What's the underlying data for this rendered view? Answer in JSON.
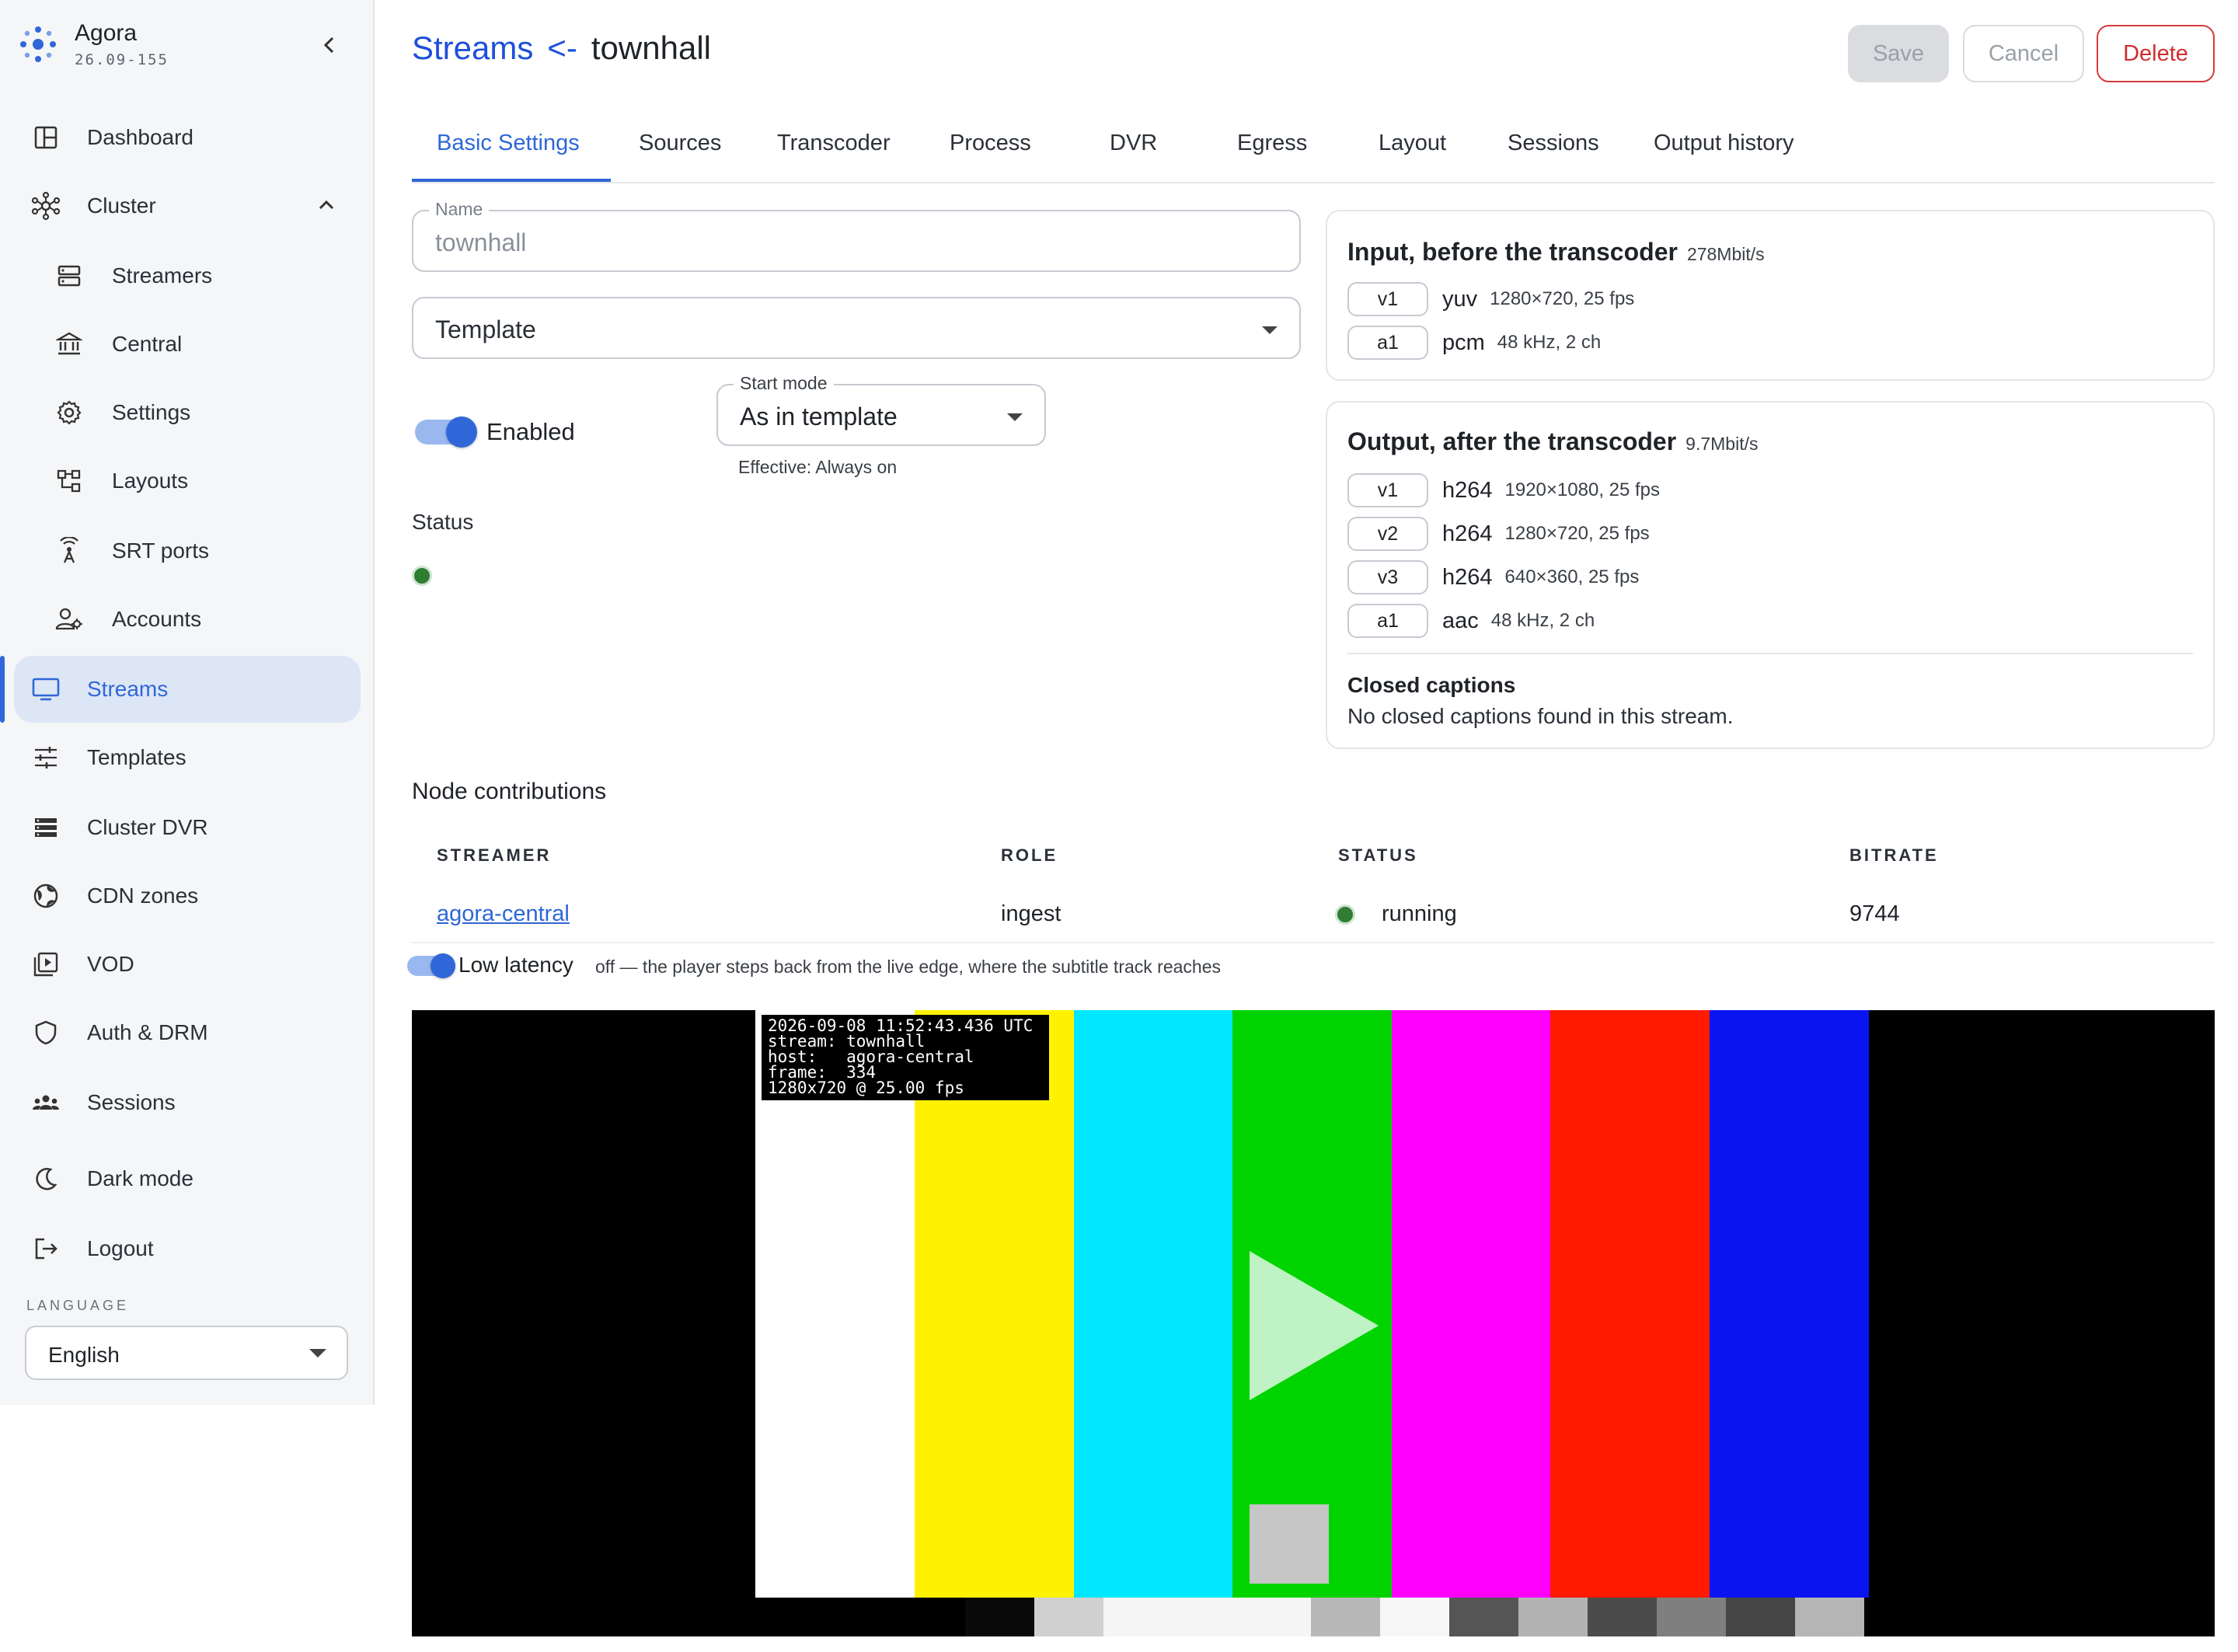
{
  "app": {
    "name": "Agora",
    "version": "26.09-155"
  },
  "sidebar": {
    "items": [
      {
        "label": "Dashboard",
        "icon": "dashboard-icon"
      },
      {
        "label": "Cluster",
        "icon": "cluster-icon",
        "expanded": true
      },
      {
        "label": "Streamers",
        "icon": "server-icon"
      },
      {
        "label": "Central",
        "icon": "bank-icon"
      },
      {
        "label": "Settings",
        "icon": "gear-icon"
      },
      {
        "label": "Layouts",
        "icon": "layouts-icon"
      },
      {
        "label": "SRT ports",
        "icon": "antenna-icon"
      },
      {
        "label": "Accounts",
        "icon": "accounts-icon"
      },
      {
        "label": "Streams",
        "icon": "monitor-icon",
        "active": true
      },
      {
        "label": "Templates",
        "icon": "sliders-icon"
      },
      {
        "label": "Cluster DVR",
        "icon": "storage-icon"
      },
      {
        "label": "CDN zones",
        "icon": "globe-icon"
      },
      {
        "label": "VOD",
        "icon": "video-library-icon"
      },
      {
        "label": "Auth & DRM",
        "icon": "shield-icon"
      },
      {
        "label": "Sessions",
        "icon": "group-icon"
      },
      {
        "label": "Dark mode",
        "icon": "moon-icon"
      },
      {
        "label": "Logout",
        "icon": "logout-icon"
      }
    ],
    "language_label": "LANGUAGE",
    "language_value": "English"
  },
  "header": {
    "crumb_parent": "Streams",
    "crumb_sep": "<-",
    "crumb_current": "townhall",
    "save_label": "Save",
    "cancel_label": "Cancel",
    "delete_label": "Delete"
  },
  "tabs": [
    "Basic Settings",
    "Sources",
    "Transcoder",
    "Process",
    "DVR",
    "Egress",
    "Layout",
    "Sessions",
    "Output history"
  ],
  "form": {
    "name_label": "Name",
    "name_value": "townhall",
    "template_value": "Template",
    "enabled_label": "Enabled",
    "start_mode_label": "Start mode",
    "start_mode_value": "As in template",
    "effective_text": "Effective: Always on",
    "status_label": "Status"
  },
  "input_card": {
    "title": "Input, before the transcoder",
    "rate": "278Mbit/s",
    "tracks": [
      {
        "id": "v1",
        "codec": "yuv",
        "detail": "1280×720, 25 fps"
      },
      {
        "id": "a1",
        "codec": "pcm",
        "detail": "48 kHz, 2 ch"
      }
    ]
  },
  "output_card": {
    "title": "Output, after the transcoder",
    "rate": "9.7Mbit/s",
    "tracks": [
      {
        "id": "v1",
        "codec": "h264",
        "detail": "1920×1080, 25 fps"
      },
      {
        "id": "v2",
        "codec": "h264",
        "detail": "1280×720, 25 fps"
      },
      {
        "id": "v3",
        "codec": "h264",
        "detail": "640×360, 25 fps"
      },
      {
        "id": "a1",
        "codec": "aac",
        "detail": "48 kHz, 2 ch"
      }
    ],
    "cc_title": "Closed captions",
    "cc_text": "No closed captions found in this stream."
  },
  "node_contributions": {
    "title": "Node contributions",
    "columns": [
      "STREAMER",
      "ROLE",
      "STATUS",
      "BITRATE"
    ],
    "rows": [
      {
        "streamer": "agora-central",
        "role": "ingest",
        "status": "running",
        "bitrate": "9744"
      }
    ]
  },
  "low_latency": {
    "label": "Low latency",
    "note": "off — the player steps back from the live edge, where the subtitle track reaches"
  },
  "video": {
    "overlay_lines": [
      "2026-09-08 11:52:43.436 UTC",
      "stream: townhall",
      "host:   agora-central",
      "frame:  334",
      "1280x720 @ 25.00 fps"
    ],
    "bar_colors": [
      "#ffffff",
      "#fff200",
      "#00e7ff",
      "#00d400",
      "#ff00ff",
      "#ff1a00",
      "#0a14f0"
    ],
    "gray_colors": [
      "#0a0a0a",
      "#d0d0d0",
      "#f5f5f5",
      "#f5f5f5",
      "#f5f5f5",
      "#b8b8b8",
      "#f7f7f7",
      "#555555",
      "#b3b3b3",
      "#4b4b4b",
      "#7f7f7f",
      "#454545",
      "#b5b5b5"
    ],
    "play_icon": "play-icon"
  },
  "colors": {
    "accent": "#2f67d8",
    "link": "#1d4fd8",
    "danger": "#d12c2c",
    "status_ok": "#2e7d32"
  }
}
